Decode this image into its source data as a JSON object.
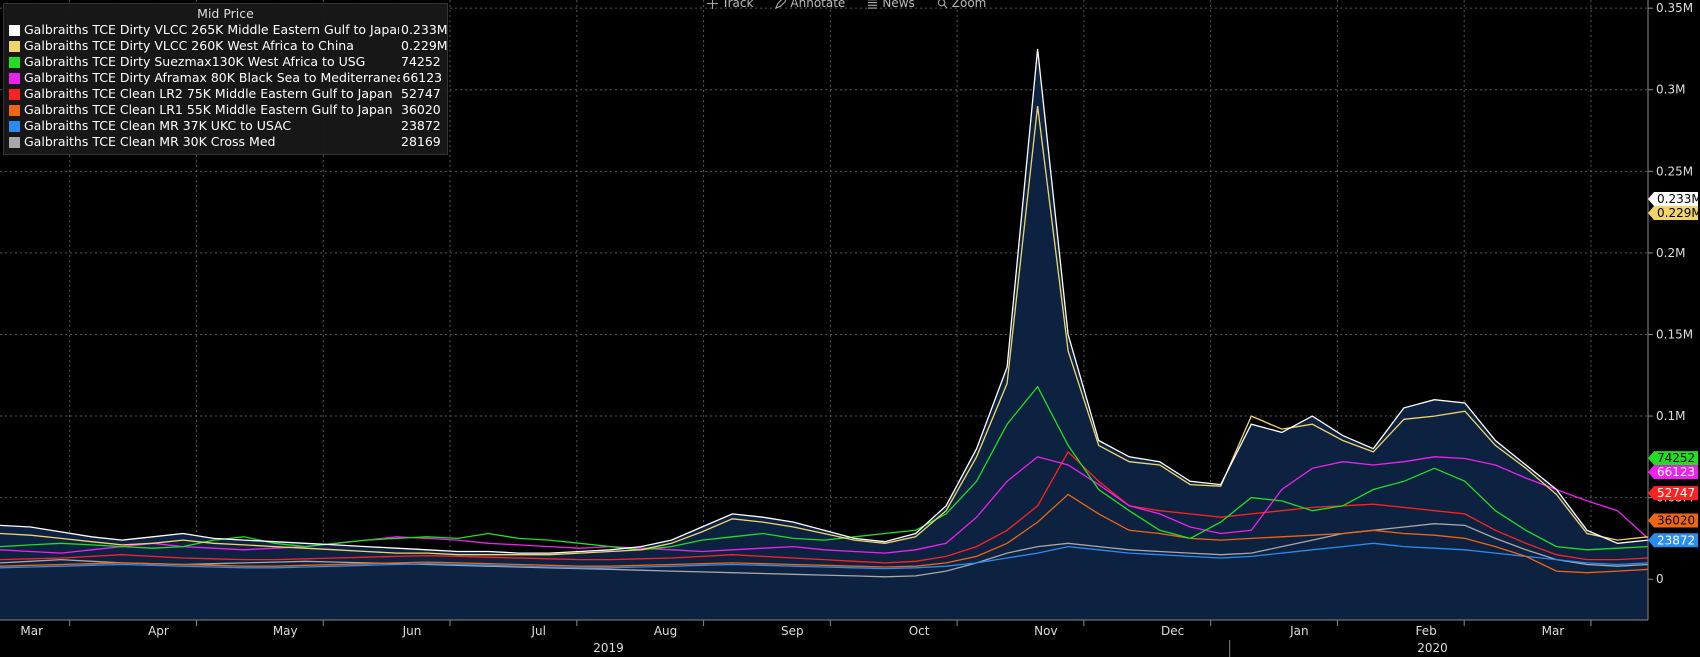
{
  "toolbar": {
    "track": "Track",
    "annotate": "Annotate",
    "news": "News",
    "zoom": "Zoom"
  },
  "legend": {
    "title": "Mid Price",
    "items": [
      {
        "name": "Galbraiths TCE Dirty VLCC 265K Middle Eastern Gulf to Japan",
        "value": "0.233M",
        "color": "#ffffff"
      },
      {
        "name": "Galbraiths TCE Dirty VLCC 260K West Africa to China",
        "value": "0.229M",
        "color": "#f1d56b"
      },
      {
        "name": "Galbraiths TCE Dirty Suezmax130K West Africa to USG",
        "value": "74252",
        "color": "#22dd22"
      },
      {
        "name": "Galbraiths TCE Dirty Aframax 80K Black Sea to Mediterranean",
        "value": "66123",
        "color": "#ee22ee"
      },
      {
        "name": "Galbraiths TCE Clean LR2 75K Middle Eastern Gulf to Japan",
        "value": "52747",
        "color": "#ff2222"
      },
      {
        "name": "Galbraiths TCE Clean LR1 55K Middle Eastern Gulf to Japan",
        "value": "36020",
        "color": "#ee6611"
      },
      {
        "name": "Galbraiths TCE Clean MR 37K UKC to USAC",
        "value": "23872",
        "color": "#2a8cf0"
      },
      {
        "name": "Galbraiths TCE Clean MR 30K Cross Med",
        "value": "28169",
        "color": "#a8a8a8"
      }
    ]
  },
  "chart_data": {
    "type": "line",
    "x_months": [
      "Mar",
      "Apr",
      "May",
      "Jun",
      "Jul",
      "Aug",
      "Sep",
      "Oct",
      "Nov",
      "Dec",
      "Jan",
      "Feb",
      "Mar"
    ],
    "x_years": [
      "2019",
      "2020"
    ],
    "y_ticks": [
      "0",
      "0.05M",
      "0.1M",
      "0.15M",
      "0.2M",
      "0.25M",
      "0.3M",
      "0.35M"
    ],
    "ylim": [
      -25000,
      355000
    ],
    "x_range": [
      0,
      54
    ],
    "grid": true,
    "area_under_first_series": true,
    "x": [
      0,
      1,
      2,
      3,
      4,
      5,
      6,
      7,
      8,
      9,
      10,
      11,
      12,
      13,
      14,
      15,
      16,
      17,
      18,
      19,
      20,
      21,
      22,
      23,
      24,
      25,
      26,
      27,
      28,
      29,
      30,
      31,
      32,
      33,
      34,
      35,
      36,
      37,
      38,
      39,
      40,
      41,
      42,
      43,
      44,
      45,
      46,
      47,
      48,
      49,
      50,
      51,
      52,
      53,
      54
    ],
    "series": [
      {
        "name": "Galbraiths TCE Dirty VLCC 265K Middle Eastern Gulf to Japan",
        "color": "#ffffff",
        "values": [
          33000,
          32000,
          29000,
          26000,
          24000,
          26000,
          28000,
          25000,
          24000,
          23000,
          22000,
          21000,
          20000,
          19000,
          18000,
          17000,
          17000,
          16000,
          16000,
          17000,
          18000,
          20000,
          24000,
          32000,
          40000,
          38000,
          35000,
          30000,
          25000,
          23000,
          28000,
          45000,
          80000,
          130000,
          325000,
          150000,
          85000,
          75000,
          72000,
          60000,
          58000,
          95000,
          90000,
          100000,
          88000,
          80000,
          105000,
          110000,
          108000,
          85000,
          70000,
          55000,
          30000,
          22000,
          24000
        ]
      },
      {
        "name": "Galbraiths TCE Dirty VLCC 260K West Africa to China",
        "color": "#f1d56b",
        "values": [
          28000,
          27000,
          25000,
          23000,
          21000,
          22000,
          24000,
          22000,
          21000,
          20000,
          19000,
          18000,
          17000,
          16000,
          16000,
          15000,
          15000,
          15000,
          15000,
          16000,
          17000,
          18000,
          22000,
          29000,
          37000,
          35000,
          32000,
          28000,
          24000,
          22000,
          26000,
          42000,
          75000,
          120000,
          290000,
          140000,
          82000,
          72000,
          70000,
          58000,
          57000,
          100000,
          92000,
          95000,
          85000,
          78000,
          98000,
          100000,
          103000,
          82000,
          68000,
          52000,
          28000,
          24000,
          26000
        ]
      },
      {
        "name": "Galbraiths TCE Dirty Suezmax130K West Africa to USG",
        "color": "#22dd22",
        "values": [
          20000,
          21000,
          22000,
          21000,
          20000,
          19000,
          20000,
          24000,
          26000,
          22000,
          20000,
          22000,
          24000,
          25000,
          26000,
          25000,
          28000,
          25000,
          24000,
          22000,
          20000,
          18000,
          20000,
          24000,
          26000,
          28000,
          25000,
          24000,
          26000,
          28000,
          30000,
          40000,
          60000,
          95000,
          118000,
          82000,
          55000,
          42000,
          30000,
          25000,
          35000,
          50000,
          48000,
          42000,
          45000,
          55000,
          60000,
          68000,
          60000,
          42000,
          30000,
          20000,
          18000,
          19000,
          20000
        ]
      },
      {
        "name": "Galbraiths TCE Dirty Aframax 80K Black Sea to Mediterranean",
        "color": "#ee22ee",
        "values": [
          18000,
          17000,
          16000,
          18000,
          20000,
          22000,
          20000,
          19000,
          18000,
          19000,
          20000,
          22000,
          24000,
          26000,
          25000,
          24000,
          22000,
          21000,
          20000,
          19000,
          20000,
          19000,
          18000,
          17000,
          18000,
          19000,
          20000,
          18000,
          17000,
          16000,
          18000,
          22000,
          38000,
          60000,
          75000,
          70000,
          58000,
          45000,
          40000,
          32000,
          28000,
          30000,
          55000,
          68000,
          72000,
          70000,
          72000,
          75000,
          74000,
          70000,
          62000,
          55000,
          48000,
          42000,
          25000
        ]
      },
      {
        "name": "Galbraiths TCE Clean LR2 75K Middle Eastern Gulf to Japan",
        "color": "#ff2222",
        "values": [
          12000,
          12500,
          13000,
          14000,
          15000,
          14000,
          13000,
          12500,
          12000,
          12000,
          12500,
          13000,
          13500,
          14000,
          14500,
          14000,
          13500,
          13000,
          12500,
          12000,
          12000,
          12500,
          13000,
          14000,
          15000,
          14000,
          13000,
          12000,
          11000,
          10000,
          11000,
          14000,
          20000,
          30000,
          45000,
          78000,
          60000,
          45000,
          42000,
          40000,
          38000,
          40000,
          42000,
          44000,
          45000,
          46000,
          44000,
          42000,
          40000,
          30000,
          22000,
          15000,
          12000,
          12000,
          13000
        ]
      },
      {
        "name": "Galbraiths TCE Clean LR1 55K Middle Eastern Gulf to Japan",
        "color": "#ee6611",
        "values": [
          8000,
          8500,
          9000,
          9500,
          10000,
          9500,
          9000,
          8500,
          8000,
          8000,
          8500,
          9000,
          9500,
          10000,
          10500,
          10000,
          9500,
          9000,
          8500,
          8000,
          8000,
          8500,
          9000,
          9500,
          10000,
          9500,
          9000,
          8500,
          8000,
          7500,
          8000,
          10000,
          14000,
          22000,
          35000,
          52000,
          40000,
          30000,
          28000,
          25000,
          24000,
          25000,
          26000,
          27000,
          28000,
          30000,
          28000,
          27000,
          25000,
          20000,
          14000,
          5000,
          4000,
          5000,
          6000
        ]
      },
      {
        "name": "Galbraiths TCE Clean MR 37K UKC to USAC",
        "color": "#2a8cf0",
        "values": [
          7000,
          7500,
          8000,
          8500,
          9000,
          8500,
          8000,
          7500,
          7000,
          7000,
          7500,
          8000,
          8500,
          9000,
          9500,
          9000,
          8500,
          8000,
          7500,
          7000,
          7000,
          7500,
          8000,
          8500,
          9000,
          8500,
          8000,
          7500,
          7000,
          6500,
          7000,
          8000,
          10000,
          13000,
          16000,
          20000,
          18000,
          16000,
          15000,
          14000,
          13000,
          14000,
          16000,
          18000,
          20000,
          22000,
          20000,
          19000,
          18000,
          16000,
          14000,
          12000,
          10000,
          9000,
          10000
        ]
      },
      {
        "name": "Galbraiths TCE Clean MR 30K Cross Med",
        "color": "#a8a8a8",
        "values": [
          10000,
          11000,
          12000,
          11000,
          10000,
          9500,
          9000,
          9500,
          10000,
          10500,
          11000,
          10500,
          10000,
          9500,
          9000,
          8500,
          8000,
          7500,
          7000,
          6500,
          6000,
          5500,
          5000,
          4500,
          4000,
          3500,
          3000,
          2500,
          2000,
          1500,
          2000,
          5000,
          10000,
          16000,
          20000,
          22000,
          20000,
          18000,
          17000,
          16000,
          15000,
          16000,
          20000,
          24000,
          28000,
          30000,
          32000,
          34000,
          33000,
          25000,
          18000,
          12000,
          9000,
          8000,
          9000
        ]
      }
    ],
    "last_value_labels": [
      {
        "text": "0.233M",
        "value": 233000,
        "color": "#ffffff",
        "text_color": "#000000"
      },
      {
        "text": "0.229M",
        "value": 229000,
        "color": "#f1d56b",
        "text_color": "#000000"
      },
      {
        "text": "74252",
        "value": 74252,
        "color": "#22dd22",
        "text_color": "#000000"
      },
      {
        "text": "66123",
        "value": 66123,
        "color": "#ee22ee",
        "text_color": "#ffffff"
      },
      {
        "text": "52747",
        "value": 52747,
        "color": "#ff2222",
        "text_color": "#ffffff"
      },
      {
        "text": "36020",
        "value": 36020,
        "color": "#ee6611",
        "text_color": "#000000"
      },
      {
        "text": "23872",
        "value": 23872,
        "color": "#2a8cf0",
        "text_color": "#ffffff"
      }
    ]
  }
}
